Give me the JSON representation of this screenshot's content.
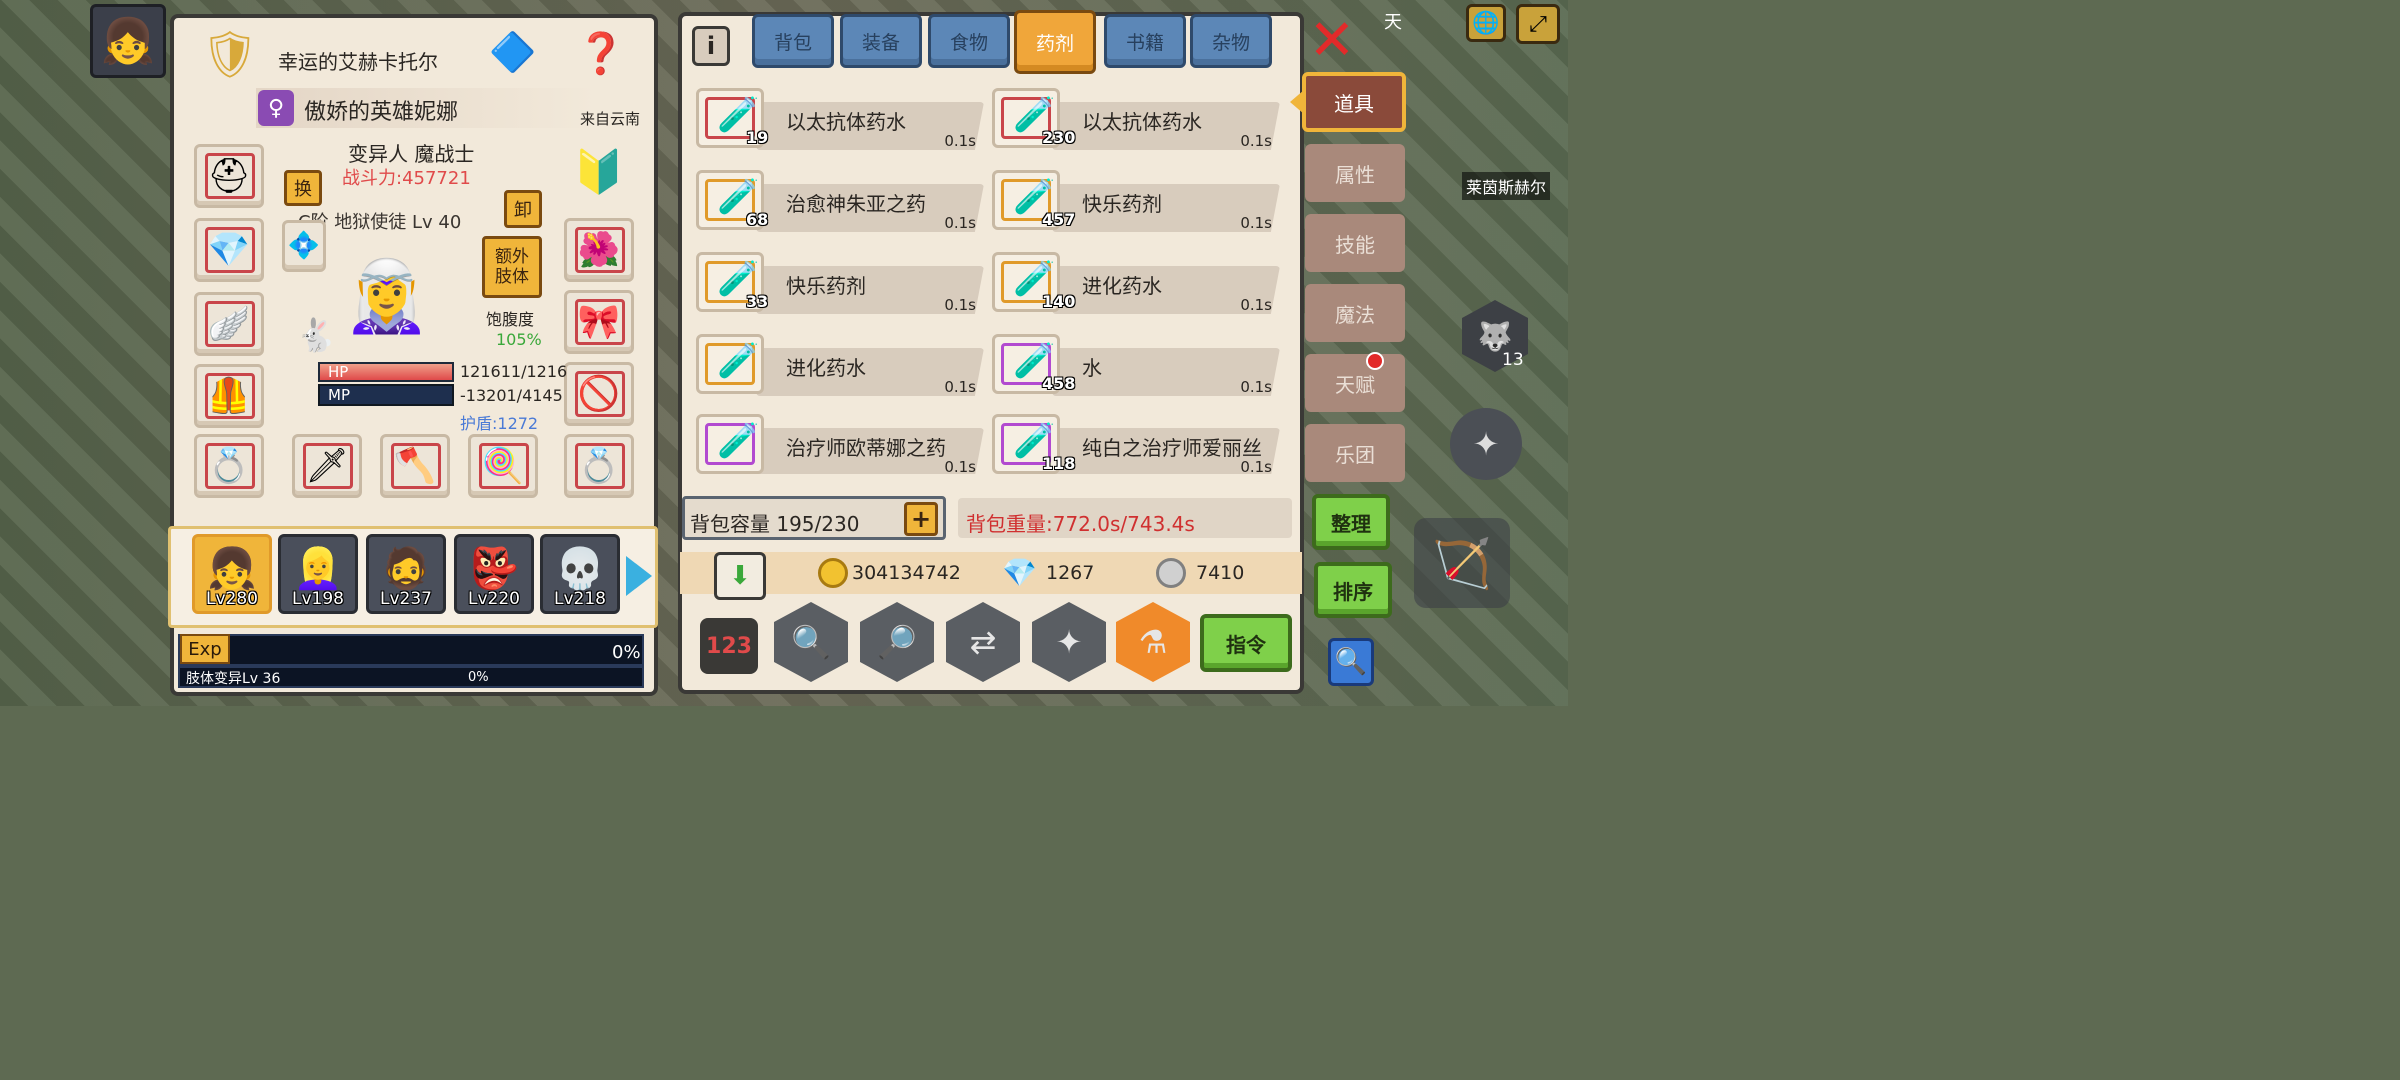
{
  "character": {
    "title_prefix": "幸运的艾赫卡托尔",
    "name": "傲娇的英雄妮娜",
    "origin": "来自云南",
    "class": "变异人 魔战士",
    "power": "战斗力:457721",
    "rank": "C阶 地狱使徒 Lv 40",
    "swap_label": "换",
    "unequip_label": "卸",
    "extra_limb_label": "额外\n肢体",
    "satiety_label": "饱腹度",
    "satiety_value": "105%",
    "hp_label": "HP",
    "mp_label": "MP",
    "hp_value": "121611/1216",
    "mp_value": "-13201/4145",
    "shield": "护盾:1272"
  },
  "party": [
    {
      "level": "Lv280"
    },
    {
      "level": "Lv198"
    },
    {
      "level": "Lv237"
    },
    {
      "level": "Lv220"
    },
    {
      "level": "Lv218"
    }
  ],
  "exp": {
    "label": "Exp",
    "percent": "0%",
    "limb_label": "肢体变异Lv 36",
    "limb_percent": "0%"
  },
  "tabs": [
    {
      "label": "背包"
    },
    {
      "label": "装备"
    },
    {
      "label": "食物"
    },
    {
      "label": "药剂"
    },
    {
      "label": "书籍"
    },
    {
      "label": "杂物"
    }
  ],
  "items": [
    {
      "name": "以太抗体药水",
      "count": "19",
      "time": "0.1s",
      "icon": "purple-potion-icon"
    },
    {
      "name": "以太抗体药水",
      "count": "230",
      "time": "0.1s",
      "icon": "purple-potion-icon"
    },
    {
      "name": "治愈神朱亚之药",
      "count": "68",
      "time": "0.1s",
      "icon": "green-potion-icon"
    },
    {
      "name": "快乐药剂",
      "count": "457",
      "time": "0.1s",
      "icon": "orange-potion-icon"
    },
    {
      "name": "快乐药剂",
      "count": "33",
      "time": "0.1s",
      "icon": "orange-potion-icon"
    },
    {
      "name": "进化药水",
      "count": "140",
      "time": "0.1s",
      "icon": "violet-potion-icon"
    },
    {
      "name": "进化药水",
      "count": "",
      "time": "0.1s",
      "icon": "violet-potion-icon"
    },
    {
      "name": "水",
      "count": "458",
      "time": "0.1s",
      "icon": "blue-potion-icon"
    },
    {
      "name": "治疗师欧蒂娜之药",
      "count": "",
      "time": "0.1s",
      "icon": "red-potion-icon"
    },
    {
      "name": "纯白之治疗师爱丽丝",
      "count": "118",
      "time": "0.1s",
      "icon": "white-potion-icon"
    }
  ],
  "bag": {
    "capacity": "背包容量 195/230",
    "weight": "背包重量:772.0s/743.4s"
  },
  "currency": {
    "gold": "304134742",
    "gem": "1267",
    "silver": "7410"
  },
  "side_tabs": [
    {
      "label": "道具"
    },
    {
      "label": "属性"
    },
    {
      "label": "技能"
    },
    {
      "label": "魔法"
    },
    {
      "label": "天赋"
    },
    {
      "label": "乐团"
    }
  ],
  "buttons": {
    "organize": "整理",
    "sort": "排序",
    "command": "指令"
  },
  "world": {
    "npc_name": "莱茵斯赫尔",
    "corner_num": "13",
    "top_text": "天"
  }
}
